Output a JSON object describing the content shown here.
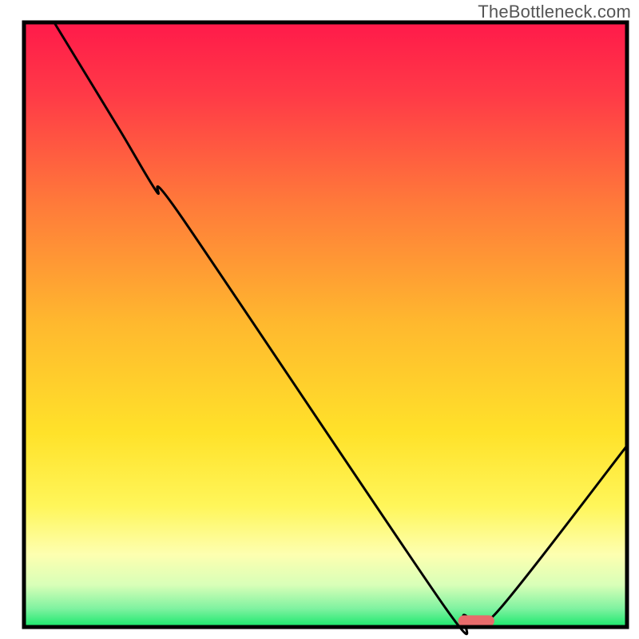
{
  "watermark": "TheBottleneck.com",
  "chart_data": {
    "type": "line",
    "title": "",
    "xlabel": "",
    "ylabel": "",
    "xlim": [
      0,
      100
    ],
    "ylim": [
      0,
      100
    ],
    "grid": false,
    "legend_position": "none",
    "series": [
      {
        "name": "bottleneck-curve",
        "x": [
          5,
          16,
          22,
          26,
          70,
          73,
          78,
          100
        ],
        "y": [
          100,
          82,
          72,
          68,
          3,
          2,
          2,
          30
        ]
      }
    ],
    "optimal_marker": {
      "x_center": 75,
      "y": 1,
      "width_pct": 6,
      "color": "#e86b6b"
    },
    "gradient_stops": [
      {
        "offset": 0.0,
        "color": "#ff1a4a"
      },
      {
        "offset": 0.12,
        "color": "#ff3a47"
      },
      {
        "offset": 0.3,
        "color": "#ff7a3a"
      },
      {
        "offset": 0.5,
        "color": "#ffb92e"
      },
      {
        "offset": 0.68,
        "color": "#ffe22a"
      },
      {
        "offset": 0.8,
        "color": "#fff65a"
      },
      {
        "offset": 0.88,
        "color": "#fdffb0"
      },
      {
        "offset": 0.93,
        "color": "#d9ffb8"
      },
      {
        "offset": 0.97,
        "color": "#7ef2a0"
      },
      {
        "offset": 1.0,
        "color": "#17e86a"
      }
    ],
    "border_color": "#000000",
    "line_color": "#000000"
  }
}
